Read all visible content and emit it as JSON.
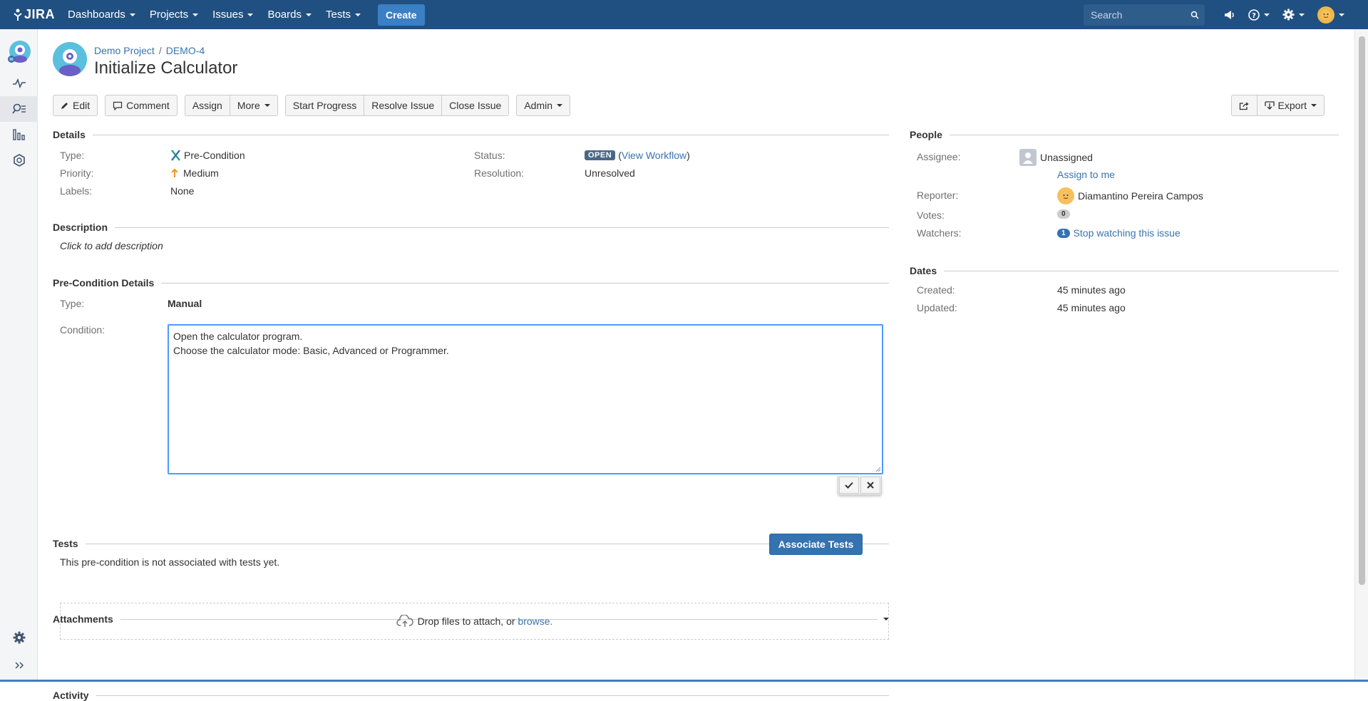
{
  "nav": {
    "logo_text": "JIRA",
    "items": [
      {
        "label": "Dashboards"
      },
      {
        "label": "Projects"
      },
      {
        "label": "Issues"
      },
      {
        "label": "Boards"
      },
      {
        "label": "Tests"
      }
    ],
    "create_label": "Create",
    "search_placeholder": "Search",
    "brand_color": "#205081"
  },
  "breadcrumbs": {
    "project": "Demo Project",
    "separator": "/",
    "issue_key": "DEMO-4"
  },
  "issue": {
    "title": "Initialize Calculator"
  },
  "toolbar": {
    "edit": "Edit",
    "comment": "Comment",
    "assign": "Assign",
    "more": "More",
    "start_progress": "Start Progress",
    "resolve_issue": "Resolve Issue",
    "close_issue": "Close Issue",
    "admin": "Admin",
    "export": "Export"
  },
  "details": {
    "heading": "Details",
    "type_label": "Type:",
    "type_value": "Pre-Condition",
    "priority_label": "Priority:",
    "priority_value": "Medium",
    "labels_label": "Labels:",
    "labels_value": "None",
    "status_label": "Status:",
    "status_value": "OPEN",
    "view_workflow": "View Workflow",
    "resolution_label": "Resolution:",
    "resolution_value": "Unresolved"
  },
  "description": {
    "heading": "Description",
    "placeholder": "Click to add description"
  },
  "precondition": {
    "heading": "Pre-Condition Details",
    "type_label": "Type:",
    "type_value": "Manual",
    "condition_label": "Condition:",
    "condition_line1": "Open the calculator program.",
    "condition_line2": "Choose the calculator mode: Basic, Advanced or Programmer."
  },
  "tests": {
    "heading": "Tests",
    "empty_text": "This pre-condition is not associated with tests yet.",
    "associate_button": "Associate Tests"
  },
  "attachments": {
    "heading": "Attachments",
    "drop_text": "Drop files to attach, or",
    "browse": "browse."
  },
  "activity": {
    "heading": "Activity"
  },
  "people": {
    "heading": "People",
    "assignee_label": "Assignee:",
    "assignee_value": "Unassigned",
    "assign_to_me": "Assign to me",
    "reporter_label": "Reporter:",
    "reporter_value": "Diamantino Pereira Campos",
    "votes_label": "Votes:",
    "votes_count": "0",
    "watchers_label": "Watchers:",
    "watchers_count": "1",
    "stop_watching": "Stop watching this issue"
  },
  "dates": {
    "heading": "Dates",
    "created_label": "Created:",
    "created_value": "45 minutes ago",
    "updated_label": "Updated:",
    "updated_value": "45 minutes ago"
  }
}
